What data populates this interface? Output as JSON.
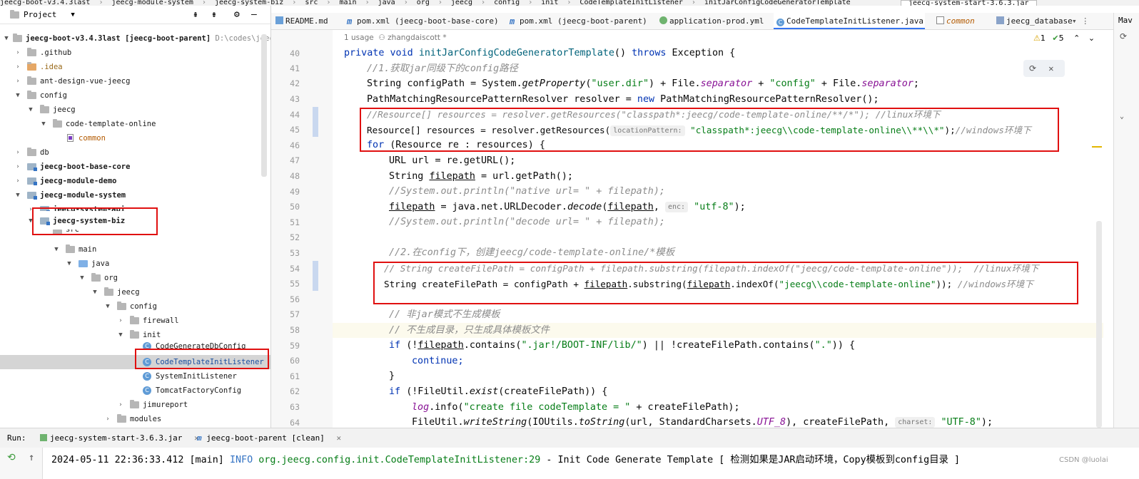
{
  "breadcrumb": [
    "jeecg-boot-v3.4.3last",
    "jeecg-module-system",
    "jeecg-system-biz",
    "src",
    "main",
    "java",
    "org",
    "jeecg",
    "config",
    "init",
    "CodeTemplateInitListener",
    "initJarConfigCodeGeneratorTemplate"
  ],
  "run_config": "jeecg-system-start-3.6.3.jar",
  "project_panel": {
    "title": "Project",
    "rows": [
      {
        "label": "jeecg-boot-v3.4.3last",
        "extra": "[jeecg-boot-parent]",
        "hint": "D:\\codes\\jeecg"
      },
      {
        "label": ".github"
      },
      {
        "label": ".idea"
      },
      {
        "label": "ant-design-vue-jeecg"
      },
      {
        "label": "config"
      },
      {
        "label": "jeecg"
      },
      {
        "label": "code-template-online"
      },
      {
        "label": "common"
      },
      {
        "label": "db"
      },
      {
        "label": "jeecg-boot-base-core"
      },
      {
        "label": "jeecg-module-demo"
      },
      {
        "label": "jeecg-module-system"
      },
      {
        "label": "jeecg-system-api"
      },
      {
        "label": "jeecg-system-biz"
      },
      {
        "label": "src"
      },
      {
        "label": "main"
      },
      {
        "label": "java"
      },
      {
        "label": "org"
      },
      {
        "label": "jeecg"
      },
      {
        "label": "config"
      },
      {
        "label": "firewall"
      },
      {
        "label": "init"
      },
      {
        "label": "CodeGenerateDbConfig"
      },
      {
        "label": "CodeTemplateInitListener"
      },
      {
        "label": "SystemInitListener"
      },
      {
        "label": "TomcatFactoryConfig"
      },
      {
        "label": "jimureport"
      },
      {
        "label": "modules"
      }
    ]
  },
  "tabs": [
    "README.md",
    "pom.xml (jeecg-boot-base-core)",
    "pom.xml (jeecg-boot-parent)",
    "application-prod.yml",
    "CodeTemplateInitListener.java",
    "common",
    "jeecg_database"
  ],
  "right_label": "Mav",
  "inspections": {
    "warnings": "1",
    "checks": "5"
  },
  "editor": {
    "usage": "1 usage",
    "author": "zhangdaiscott *",
    "line_numbers": [
      "40",
      "41",
      "42",
      "43",
      "44",
      "45",
      "46",
      "47",
      "48",
      "49",
      "50",
      "51",
      "52",
      "53",
      "54",
      "55",
      "56",
      "57",
      "58",
      "59",
      "60",
      "61",
      "62",
      "63",
      "64"
    ],
    "lines": {
      "l40": {
        "a": "private void ",
        "b": "initJarConfigCodeGeneratorTemplate",
        "c": "() ",
        "d": "throws ",
        "e": "Exception {"
      },
      "l41": "//1.获取jar同级下的config路径",
      "l42": {
        "a": "String configPath = System.",
        "b": "getProperty",
        "c": "(",
        "d": "\"user.dir\"",
        "e": ") + File.",
        "f": "separator",
        "g": " + ",
        "h": "\"config\"",
        "i": " + File.",
        "j": "separator",
        "k": ";"
      },
      "l43": {
        "a": "PathMatchingResourcePatternResolver resolver = ",
        "b": "new ",
        "c": "PathMatchingResourcePatternResolver();"
      },
      "l44": "//Resource[] resources = resolver.getResources(\"classpath*:jeecg/code-template-online/**/*\"); //linux环境下",
      "l45": {
        "a": "Resource[] resources = resolver.getResources(",
        "hint": "locationPattern:",
        "b": "\"classpath*:jeecg\\\\code-template-online\\\\**\\\\*\"",
        "c": ");",
        "d": "//windows环境下"
      },
      "l46": {
        "a": "for ",
        "b": "(Resource re : resources) {"
      },
      "l47": "URL url = re.getURL();",
      "l48": {
        "a": "String ",
        "b": "filepath",
        "c": " = url.getPath();"
      },
      "l49": "//System.out.println(\"native url= \" + filepath);",
      "l50": {
        "a": "filepath",
        "b": " = java.net.URLDecoder.",
        "c": "decode",
        "d": "(",
        "e": "filepath",
        ",f": "",
        "f": ", ",
        "hint": "enc:",
        "g": "\"utf-8\"",
        "h": ");"
      },
      "l51": "//System.out.println(\"decode url= \" + filepath);",
      "l53": "//2.在config下，创建jeecg/code-template-online/*模板",
      "l54": "// String createFilePath = configPath + filepath.substring(filepath.indexOf(\"jeecg/code-template-online\"));  //linux环境下",
      "l55": {
        "a": "String createFilePath = configPath + ",
        "b": "filepath",
        ".c": "",
        "c": ".substring(",
        "d": "filepath",
        "e": ".indexOf(",
        "f": "\"jeecg\\\\code-template-online\"",
        "g": ")); ",
        "h": "//windows环境下"
      },
      "l57": "// 非jar模式不生成模板",
      "l58": "// 不生成目录，只生成具体模板文件",
      "l59": {
        "a": "if ",
        "b": "(!",
        "c": "filepath",
        "d": ".contains(",
        "e": "\".jar!/BOOT-INF/lib/\"",
        "f": ") || !createFilePath.contains(",
        "g": "\".\"",
        "h": ")) {"
      },
      "l60": "continue;",
      "l61": "}",
      "l62": {
        "a": "if ",
        "b": "(!FileUtil.",
        "c": "exist",
        "d": "(createFilePath)) {"
      },
      "l63": {
        "a": "log",
        "b": ".info(",
        "c": "\"create file codeTemplate = \"",
        "d": " + createFilePath);"
      },
      "l64": {
        "a": "FileUtil.",
        "b": "writeString",
        "c": "(IOUtils.",
        "d": "toString",
        "e": "(url, StandardCharsets.",
        "f": "UTF_8",
        "g": "), createFilePath, ",
        "hint": "charset:",
        "h": "\"UTF-8\"",
        "i": ");"
      }
    }
  },
  "run_bar": {
    "label": "Run:",
    "tab1": "jeecg-system-start-3.6.3.jar",
    "tab2": "jeecg-boot-parent [clean]"
  },
  "console": {
    "time": "2024-05-11 22:36:33.412",
    "thread": "[main]",
    "level": "INFO",
    "logger": "org.jeecg.config.init.CodeTemplateInitListener:29",
    "sep": " -  ",
    "msg": "Init Code Generate Template [ 检测如果是JAR启动环境，Copy模板到config目录 ]"
  },
  "watermark": "CSDN @luolai",
  "colors": {
    "accent": "#3574f0",
    "highlight_box": "#e01010",
    "keyword": "#0033b3",
    "string": "#067d17",
    "comment": "#8c8c8c"
  }
}
